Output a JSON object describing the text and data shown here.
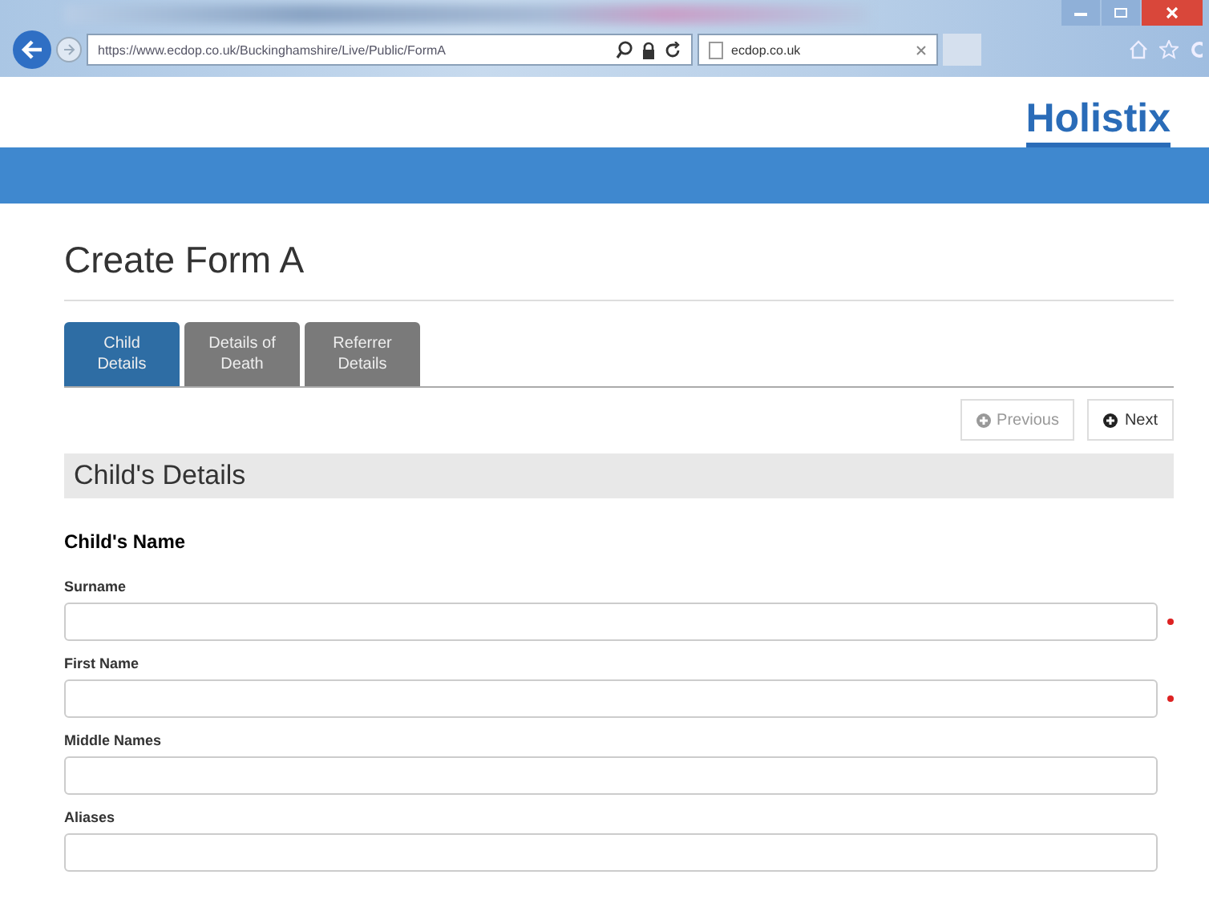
{
  "browser": {
    "address": "https://www.ecdop.co.uk/Buckinghamshire/Live/Public/FormA",
    "tab_title": "ecdop.co.uk"
  },
  "logo": "Holistix",
  "page_title": "Create Form A",
  "tabs": [
    {
      "label": "Child Details",
      "selected": true
    },
    {
      "label": "Details of Death",
      "selected": false
    },
    {
      "label": "Referrer Details",
      "selected": false
    }
  ],
  "nav_buttons": [
    {
      "label": "Previous",
      "disabled": true
    },
    {
      "label": "Next",
      "disabled": false
    }
  ],
  "section_title": "Child's Details",
  "group_title": "Child's Name",
  "fields": [
    {
      "label": "Surname",
      "required": true
    },
    {
      "label": "First Name",
      "required": true
    },
    {
      "label": "Middle Names",
      "required": false
    },
    {
      "label": "Aliases",
      "required": false
    }
  ]
}
